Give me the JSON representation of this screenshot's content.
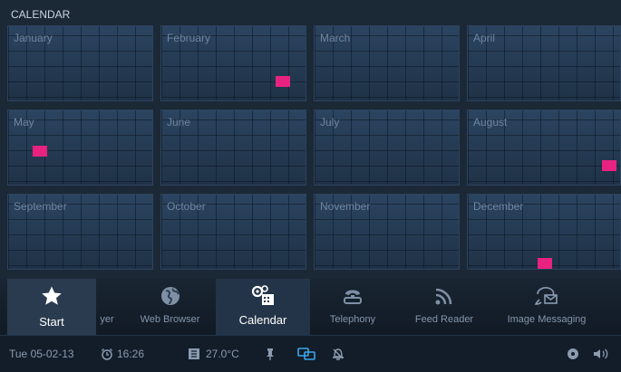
{
  "header": {
    "title": "CALENDAR"
  },
  "calendar": {
    "months": [
      {
        "name": "January"
      },
      {
        "name": "February"
      },
      {
        "name": "March"
      },
      {
        "name": "April"
      },
      {
        "name": "May"
      },
      {
        "name": "June"
      },
      {
        "name": "July"
      },
      {
        "name": "August"
      },
      {
        "name": "September"
      },
      {
        "name": "October"
      },
      {
        "name": "November"
      },
      {
        "name": "December"
      }
    ],
    "event_color": "#e8237f"
  },
  "launcher": {
    "items": [
      {
        "label": "Start",
        "icon": "star-icon"
      },
      {
        "label": "yer",
        "icon": ""
      },
      {
        "label": "Web Browser",
        "icon": "globe-icon"
      },
      {
        "label": "Calendar",
        "icon": "calendar-gear-icon"
      },
      {
        "label": "Telephony",
        "icon": "phone-icon"
      },
      {
        "label": "Feed Reader",
        "icon": "feed-icon"
      },
      {
        "label": "Image Messaging",
        "icon": "image-message-icon"
      }
    ],
    "active": "Calendar"
  },
  "status": {
    "date": "Tue 05-02-13",
    "time": "16:26",
    "temperature": "27.0°C"
  }
}
